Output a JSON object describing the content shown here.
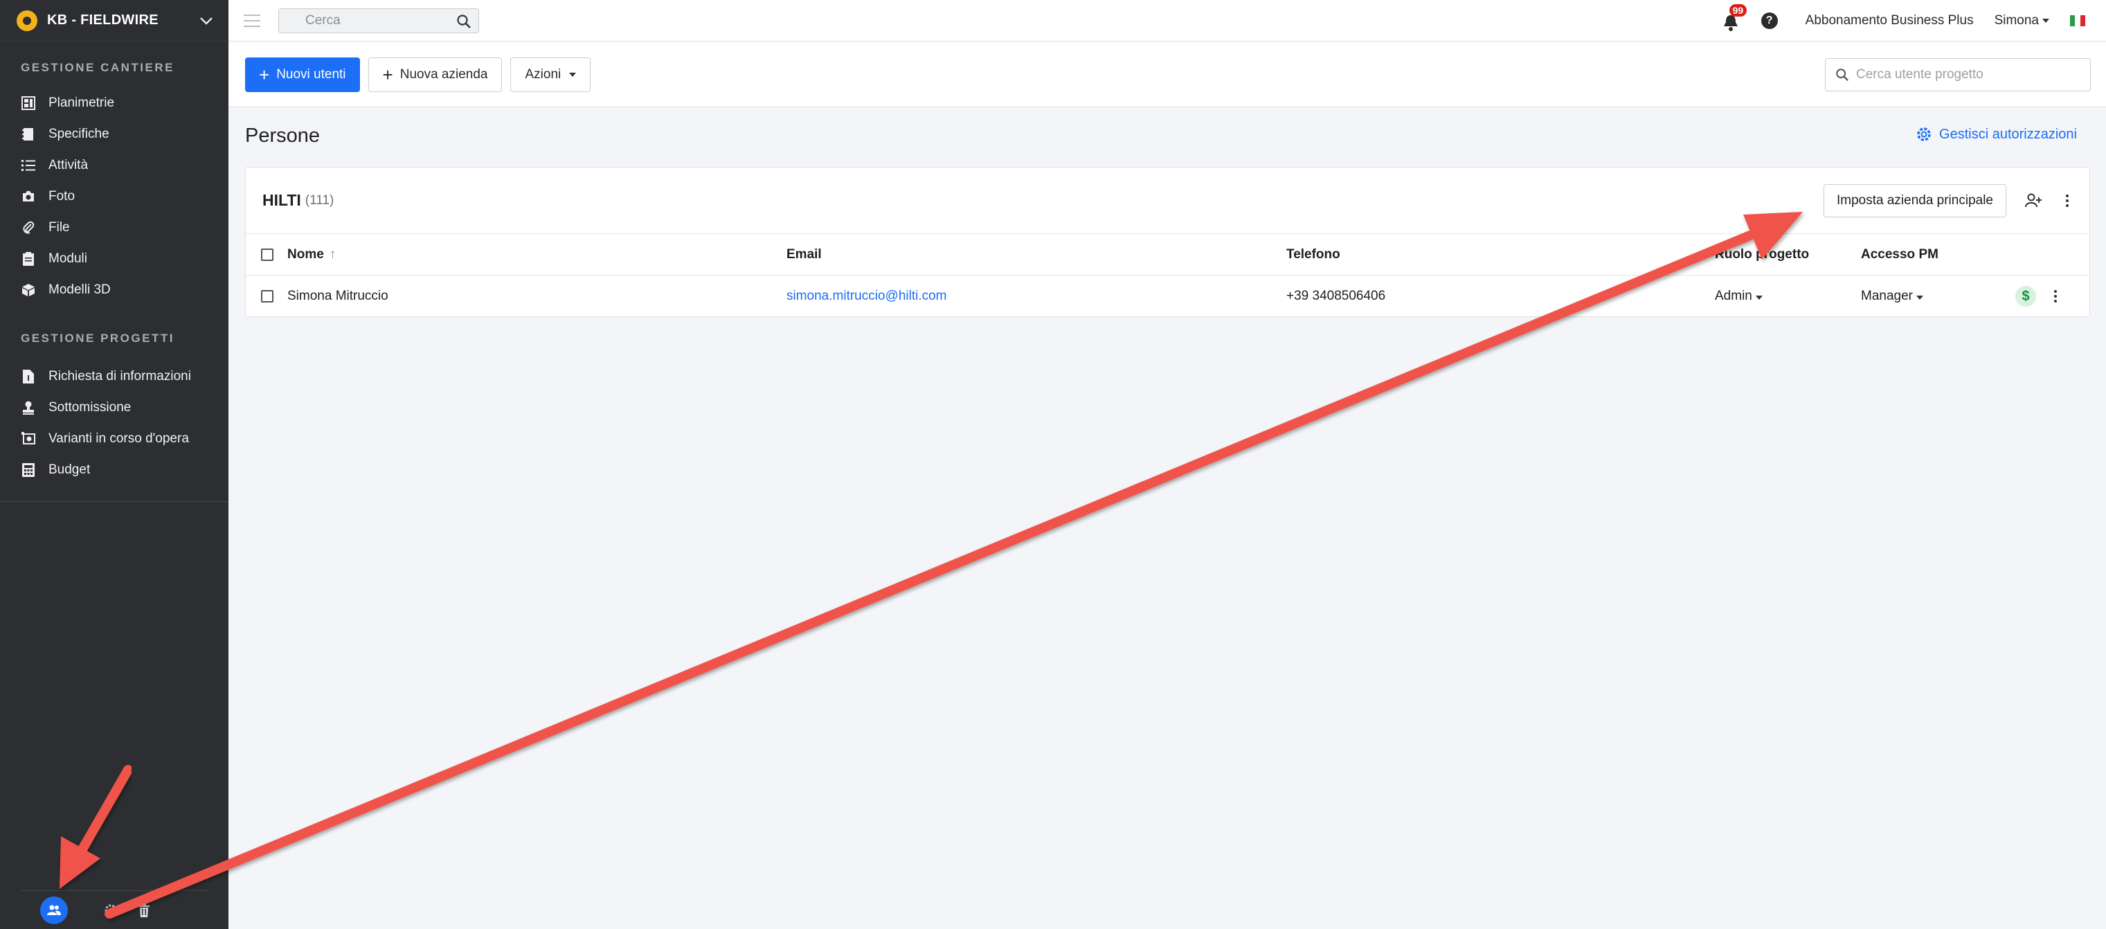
{
  "sidebar": {
    "project_name": "KB - FIELDWIRE",
    "section_site": "GESTIONE CANTIERE",
    "site_items": [
      {
        "label": "Planimetrie",
        "icon": "floorplan-icon"
      },
      {
        "label": "Specifiche",
        "icon": "specifications-icon"
      },
      {
        "label": "Attività",
        "icon": "list-icon"
      },
      {
        "label": "Foto",
        "icon": "camera-icon"
      },
      {
        "label": "File",
        "icon": "paperclip-icon"
      },
      {
        "label": "Moduli",
        "icon": "clipboard-icon"
      },
      {
        "label": "Modelli 3D",
        "icon": "cube-icon"
      }
    ],
    "section_projects": "GESTIONE PROGETTI",
    "project_items": [
      {
        "label": "Richiesta di informazioni",
        "icon": "document-info-icon"
      },
      {
        "label": "Sottomissione",
        "icon": "stamp-icon"
      },
      {
        "label": "Varianti in corso d'opera",
        "icon": "change-order-icon"
      },
      {
        "label": "Budget",
        "icon": "calculator-icon"
      }
    ],
    "bottom_icons": [
      "people-icon",
      "settings-icon",
      "trash-icon"
    ]
  },
  "topbar": {
    "search_placeholder": "Cerca",
    "notifications_count": "99",
    "help": "?",
    "subscription": "Abbonamento Business Plus",
    "user": "Simona"
  },
  "actions": {
    "new_users": "Nuovi utenti",
    "new_company": "Nuova azienda",
    "actions": "Azioni",
    "user_search_placeholder": "Cerca utente progetto"
  },
  "main": {
    "title": "Persone",
    "manage_permissions": "Gestisci autorizzazioni"
  },
  "company": {
    "name": "HILTI",
    "count": "(111)",
    "set_main": "Imposta azienda principale",
    "columns": {
      "name": "Nome",
      "email": "Email",
      "phone": "Telefono",
      "role": "Ruolo progetto",
      "pm_access": "Accesso PM"
    },
    "rows": [
      {
        "name": "Simona Mitruccio",
        "email": "simona.mitruccio@hilti.com",
        "phone": "+39 3408506406",
        "role": "Admin",
        "pm_access": "Manager",
        "billing": "$"
      }
    ]
  },
  "colors": {
    "accent": "#1b6ef5",
    "sidebar_bg": "#2c2e31",
    "badge": "#d91e18",
    "annotation_arrow": "#f0524a"
  }
}
